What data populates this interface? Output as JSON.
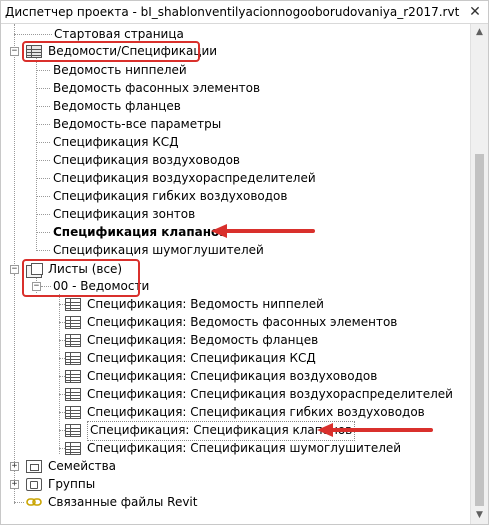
{
  "window": {
    "title": "Диспетчер проекта - bI_shablonventilyacionnogooborudovaniya_r2017.rvt",
    "close_glyph": "✕"
  },
  "tree": {
    "start_page": "Стартовая страница",
    "schedules_group": "Ведомости/Спецификации",
    "schedules": [
      "Ведомость ниппелей",
      "Ведомость фасонных элементов",
      "Ведомость фланцев",
      "Ведомость-все параметры",
      "Спецификация КСД",
      "Спецификация воздуховодов",
      "Спецификация воздухораспределителей",
      "Спецификация гибких воздуховодов",
      "Спецификация зонтов",
      "Спецификация клапанов",
      "Спецификация шумоглушителей"
    ],
    "sheets_group": "Листы (все)",
    "sheet": "00 - Ведомости",
    "sheet_schedules": [
      "Спецификация: Ведомость ниппелей",
      "Спецификация: Ведомость фасонных элементов",
      "Спецификация: Ведомость фланцев",
      "Спецификация: Спецификация КСД",
      "Спецификация: Спецификация воздуховодов",
      "Спецификация: Спецификация воздухораспределителей",
      "Спецификация: Спецификация гибких воздуховодов",
      "Спецификация: Спецификация клапанов",
      "Спецификация: Спецификация шумоглушителей"
    ],
    "families": "Семейства",
    "groups": "Группы",
    "revit_links": "Связанные файлы Revit"
  },
  "icons": {
    "schedule": "schedule-icon",
    "sheets": "sheets-icon",
    "families": "families-icon",
    "groups": "groups-icon",
    "links": "revit-links-icon",
    "expand": "plus",
    "collapse": "minus"
  },
  "colors": {
    "highlight": "#d9302c",
    "tree_lines": "#9a9a9a"
  }
}
